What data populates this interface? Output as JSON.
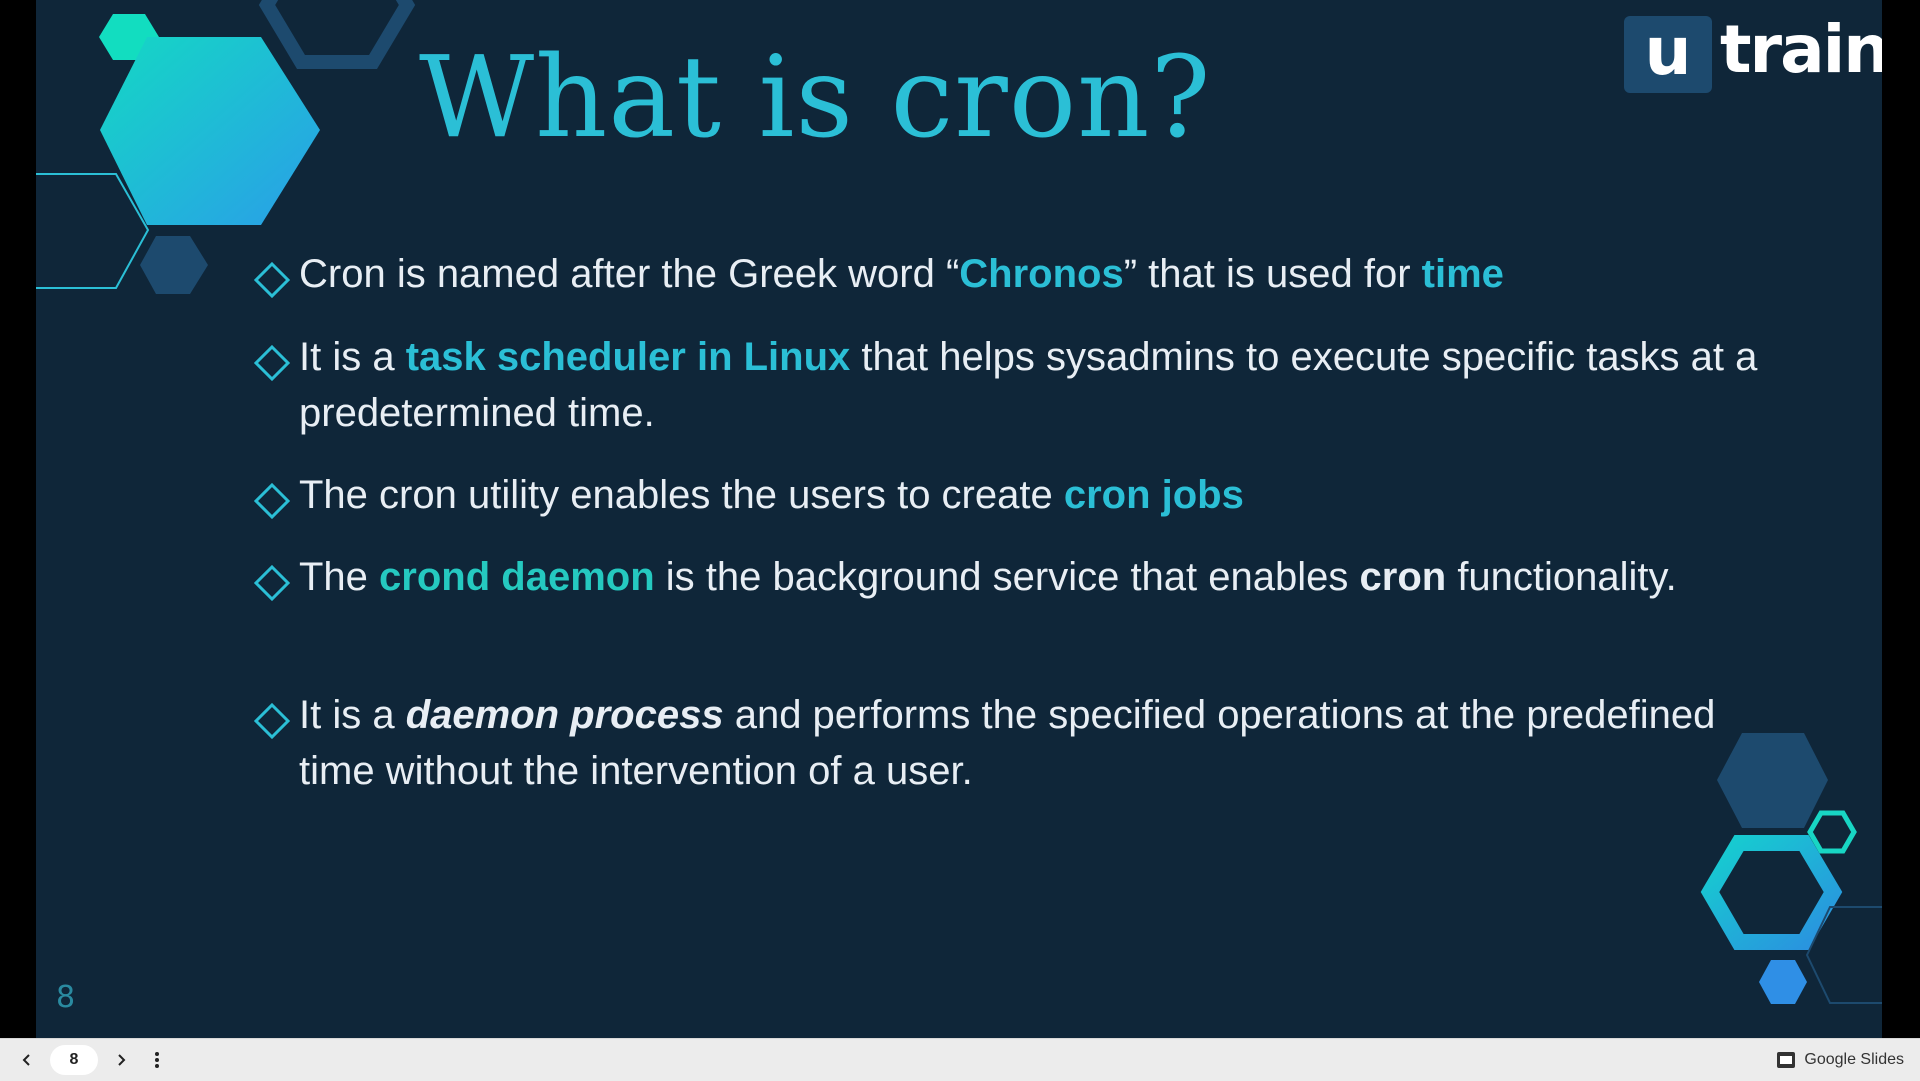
{
  "slide": {
    "title": "What is cron?",
    "logo": {
      "mark": "u",
      "text": "train"
    },
    "slide_number": "8",
    "bullets": [
      {
        "parts": [
          {
            "text": "Cron is named after the Greek word “",
            "style": "normal"
          },
          {
            "text": "Chronos",
            "style": "highlight"
          },
          {
            "text": "” that is used for ",
            "style": "normal"
          },
          {
            "text": "time",
            "style": "highlight"
          }
        ]
      },
      {
        "parts": [
          {
            "text": "It is a ",
            "style": "normal"
          },
          {
            "text": "task scheduler in Linux",
            "style": "highlight"
          },
          {
            "text": " that helps sysadmins to execute specific tasks at a predetermined time.",
            "style": "normal"
          }
        ]
      },
      {
        "parts": [
          {
            "text": "The cron utility enables the users to create ",
            "style": "normal"
          },
          {
            "text": "cron jobs",
            "style": "highlight"
          }
        ]
      },
      {
        "parts": [
          {
            "text": "The ",
            "style": "normal"
          },
          {
            "text": "crond daemon",
            "style": "highlight-green"
          },
          {
            "text": " is the background service that enables ",
            "style": "normal"
          },
          {
            "text": "cron",
            "style": "bold"
          },
          {
            "text": " functionality.",
            "style": "normal"
          }
        ]
      },
      {
        "parts": [
          {
            "text": "It is a ",
            "style": "normal"
          },
          {
            "text": "daemon process",
            "style": "bold-italic"
          },
          {
            "text": " and performs the specified operations at the predefined time without the intervention of a user.",
            "style": "normal"
          }
        ]
      }
    ]
  },
  "player": {
    "current_page": "8",
    "brand": "Google Slides",
    "icons": {
      "prev": "chevron-left-icon",
      "next": "chevron-right-icon",
      "menu": "more-vertical-icon",
      "brand": "slides-icon"
    }
  },
  "colors": {
    "background": "#0f2639",
    "accent": "#2bbfd6",
    "accent_green": "#25c9c0",
    "text": "#e8eef4",
    "hex_dark": "#1d4a6e"
  }
}
